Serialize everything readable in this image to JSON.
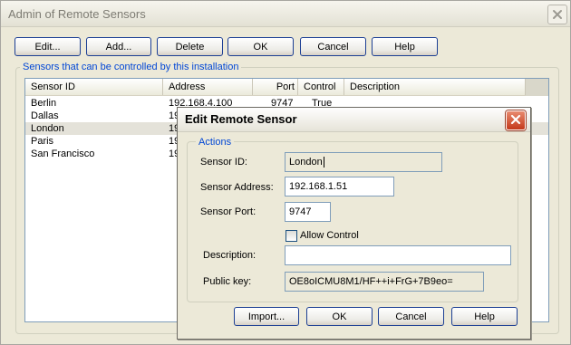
{
  "main_window": {
    "title": "Admin of Remote Sensors",
    "toolbar": {
      "edit": "Edit...",
      "add": "Add...",
      "delete": "Delete",
      "ok": "OK",
      "cancel": "Cancel",
      "help": "Help"
    },
    "group_label": "Sensors that can be controlled by this installation",
    "columns": [
      "Sensor ID",
      "Address",
      "Port",
      "Control",
      "Description"
    ],
    "rows": [
      {
        "id": "Berlin",
        "address": "192.168.4.100",
        "port": "9747",
        "control": "True",
        "description": ""
      },
      {
        "id": "Dallas",
        "address": "19",
        "port": "",
        "control": "",
        "description": ""
      },
      {
        "id": "London",
        "address": "19",
        "port": "",
        "control": "",
        "description": ""
      },
      {
        "id": "Paris",
        "address": "19",
        "port": "",
        "control": "",
        "description": ""
      },
      {
        "id": "San Francisco",
        "address": "19",
        "port": "",
        "control": "",
        "description": ""
      }
    ],
    "selected_row": 2
  },
  "edit_dialog": {
    "title": "Edit Remote Sensor",
    "group_label": "Actions",
    "sensor_id_label": "Sensor ID:",
    "sensor_id_value": "London",
    "sensor_address_label": "Sensor Address:",
    "sensor_address_value": "192.168.1.51",
    "sensor_port_label": "Sensor Port:",
    "sensor_port_value": "9747",
    "allow_control_label": "Allow Control",
    "allow_control_checked": false,
    "description_label": "Description:",
    "description_value": "",
    "public_key_label": "Public key:",
    "public_key_value": "OE8oICMU8M1/HF++i+FrG+7B9eo=",
    "buttons": {
      "import": "Import...",
      "ok": "OK",
      "cancel": "Cancel",
      "help": "Help"
    }
  },
  "colors": {
    "group_label": "#0046d5",
    "button_border": "#1c3f94",
    "close_red": "#c4391b",
    "window_bg": "#ece9d8"
  },
  "icons": {
    "main_close": "close-icon",
    "dialog_close": "close-icon"
  }
}
